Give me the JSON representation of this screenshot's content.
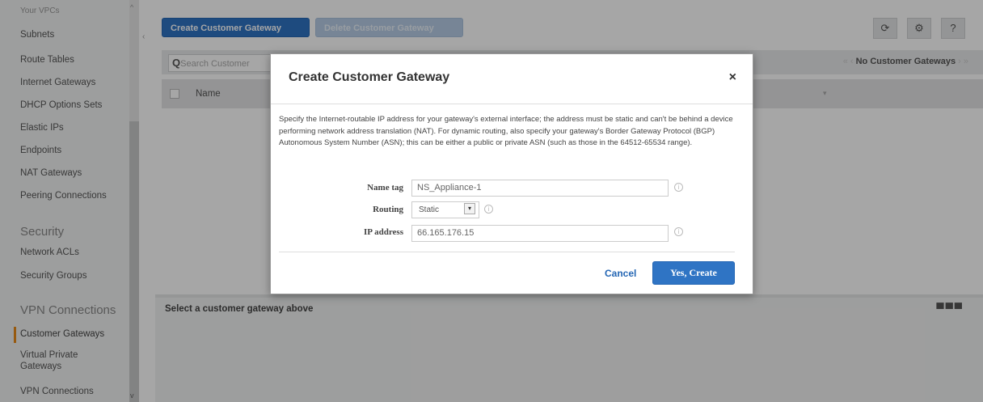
{
  "sidebar": {
    "items": [
      {
        "label": "Your VPCs"
      },
      {
        "label": "Subnets"
      },
      {
        "label": "Route Tables"
      },
      {
        "label": "Internet Gateways"
      },
      {
        "label": "DHCP Options Sets"
      },
      {
        "label": "Elastic IPs"
      },
      {
        "label": "Endpoints"
      },
      {
        "label": "NAT Gateways"
      },
      {
        "label": "Peering Connections"
      }
    ],
    "section_security": "Security",
    "security_items": [
      {
        "label": "Network ACLs"
      },
      {
        "label": "Security Groups"
      }
    ],
    "section_vpn": "VPN Connections",
    "vpn_items": [
      {
        "label": "Customer Gateways"
      },
      {
        "label": "Virtual Private Gateways"
      },
      {
        "label": "VPN Connections"
      }
    ]
  },
  "toolbar": {
    "create_label": "Create Customer Gateway",
    "delete_label": "Delete Customer Gateway",
    "refresh_icon": "refresh-icon",
    "settings_icon": "gear-icon",
    "help_icon": "help-icon"
  },
  "filter": {
    "search_placeholder": "Search Customer",
    "pager_text": "No Customer Gateways"
  },
  "table": {
    "columns": [
      "Name"
    ]
  },
  "detail": {
    "label": "Select a customer gateway above"
  },
  "modal": {
    "title": "Create Customer Gateway",
    "close": "×",
    "description": "Specify the Internet-routable IP address for your gateway's external interface; the address must be static and can't be behind a device performing network address translation (NAT). For dynamic routing, also specify your gateway's Border Gateway Protocol (BGP) Autonomous System Number (ASN); this can be either a public or private ASN (such as those in the 64512-65534 range).",
    "fields": {
      "name_label": "Name tag",
      "name_value": "NS_Appliance-1",
      "routing_label": "Routing",
      "routing_value": "Static",
      "ip_label": "IP address",
      "ip_value": "66.165.176.15"
    },
    "cancel_label": "Cancel",
    "create_label": "Yes, Create"
  },
  "colors": {
    "primary": "#2f74c4",
    "active_marker": "#e88a1a"
  }
}
